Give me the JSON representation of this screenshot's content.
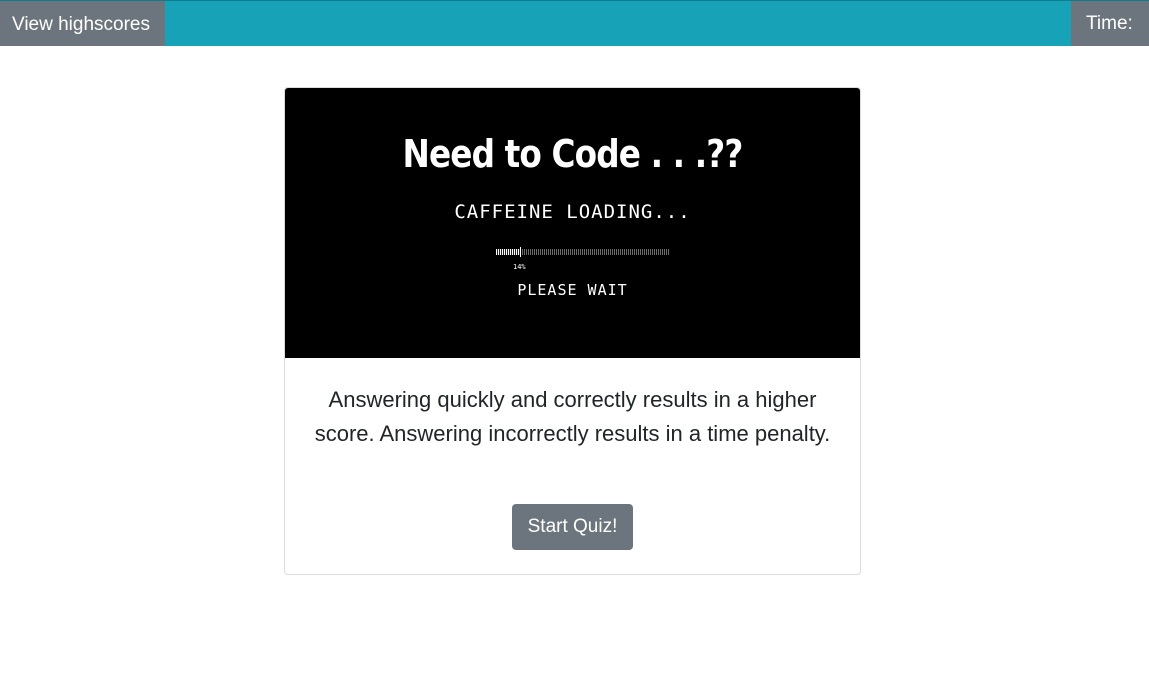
{
  "topbar": {
    "highscores_label": "View highscores",
    "timer_label": "Time:"
  },
  "banner": {
    "title": "Need to Code . . .??",
    "subtitle": "CAFFEINE LOADING...",
    "progress_percent": 14,
    "progress_label": "14%",
    "wait_text": "PLEASE WAIT"
  },
  "card": {
    "description": "Answering quickly and correctly results in a higher score. Answering incorrectly results in a time penalty.",
    "start_label": "Start Quiz!"
  },
  "colors": {
    "topbar_bg": "#17a2b8",
    "button_bg": "#6c757d",
    "banner_bg": "#000000"
  }
}
